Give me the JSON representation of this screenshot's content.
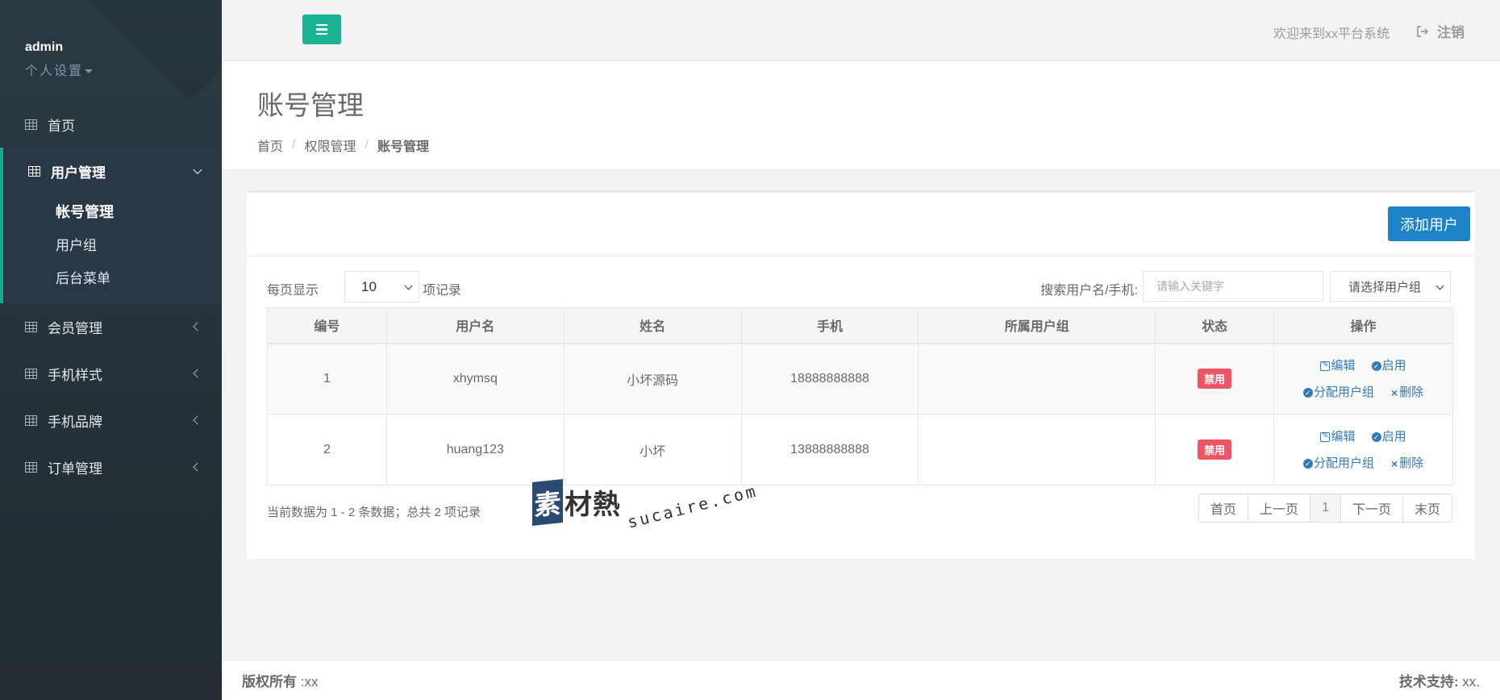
{
  "sidebar": {
    "profile_name": "admin",
    "profile_settings": "个人设置",
    "home": "首页",
    "user_mgmt": "用户管理",
    "sub_items": [
      "帐号管理",
      "用户组",
      "后台菜单"
    ],
    "member_mgmt": "会员管理",
    "phone_style": "手机样式",
    "phone_brand": "手机品牌",
    "order_mgmt": "订单管理",
    "accent_color": "#19aa8d"
  },
  "topbar": {
    "welcome": "欢迎来到xx平台系统",
    "logout": "注销"
  },
  "page": {
    "title": "账号管理",
    "breadcrumb": [
      "首页",
      "权限管理",
      "账号管理"
    ]
  },
  "panel": {
    "add_user": "添加用户",
    "perpage_label": "每页显示",
    "perpage_value": "10",
    "records_label": "项记录",
    "search_label": "搜索用户名/手机:",
    "search_placeholder": "请输入关键字",
    "group_select": "请选择用户组"
  },
  "table": {
    "headers": [
      "编号",
      "用户名",
      "姓名",
      "手机",
      "所属用户组",
      "状态",
      "操作"
    ],
    "rows": [
      {
        "id": "1",
        "username": "xhymsq",
        "name": "小坏源码",
        "phone": "18888888888",
        "group": "",
        "status": "禁用"
      },
      {
        "id": "2",
        "username": "huang123",
        "name": "小坏",
        "phone": "13888888888",
        "group": "",
        "status": "禁用"
      }
    ],
    "ops": {
      "edit": "编辑",
      "enable": "启用",
      "assign": "分配用户组",
      "delete": "删除"
    }
  },
  "summary": "当前数据为 1 - 2 条数据；总共 2 项记录",
  "pager": [
    "首页",
    "上一页",
    "1",
    "下一页",
    "末页"
  ],
  "watermark": {
    "box": "素",
    "text": "材熱",
    "url": "sucaire.com"
  },
  "footer": {
    "copyright_label": "版权所有",
    "copyright_value": ":xx",
    "support_label": "技术支持:",
    "support_value": "xx."
  }
}
